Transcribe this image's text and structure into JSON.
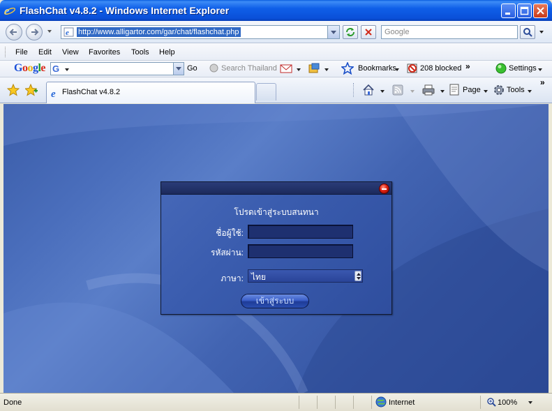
{
  "window": {
    "title": "FlashChat v4.8.2 - Windows Internet Explorer",
    "accent": "#0a4fd8"
  },
  "address": {
    "url": "http://www.alligartor.com/gar/chat/flashchat.php",
    "search_placeholder": "Google"
  },
  "menu": {
    "file": "File",
    "edit": "Edit",
    "view": "View",
    "favorites": "Favorites",
    "tools": "Tools",
    "help": "Help"
  },
  "google_toolbar": {
    "logo": "Google",
    "go_label": "Go",
    "search_site": "Search Thailand",
    "bookmarks": "Bookmarks",
    "blocked": "208 blocked",
    "settings": "Settings"
  },
  "tabs": [
    {
      "label": "FlashChat v4.8.2"
    }
  ],
  "commands": {
    "page": "Page",
    "tools": "Tools"
  },
  "dialog": {
    "heading": "โปรดเข้าสู่ระบบสนทนา",
    "username_label": "ชื่อผู้ใช้:",
    "password_label": "รหัสผ่าน:",
    "language_label": "ภาษา:",
    "language_value": "ไทย",
    "login_button": "เข้าสู่ระบบ"
  },
  "status": {
    "text": "Done",
    "zone": "Internet",
    "zoom": "100%"
  }
}
